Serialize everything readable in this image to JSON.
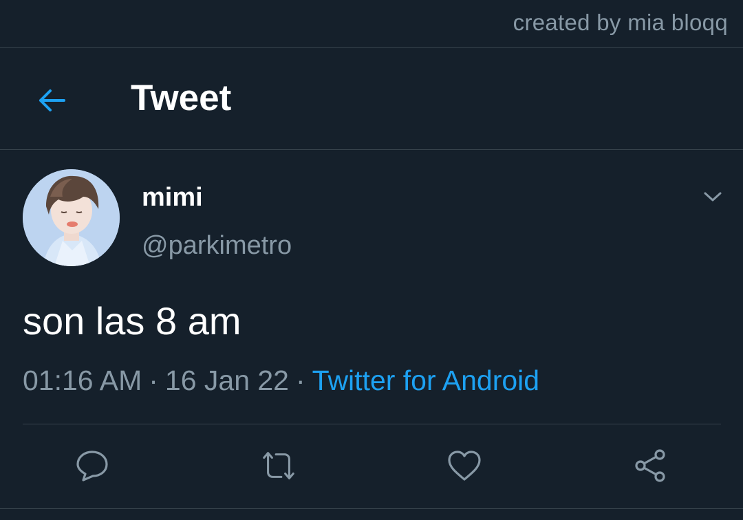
{
  "watermark": "created by mia bloqq",
  "header": {
    "back_icon": "arrow-left-icon",
    "title": "Tweet"
  },
  "tweet": {
    "author": {
      "display_name": "mimi",
      "handle": "@parkimetro"
    },
    "text": "son las 8 am",
    "time": "01:16 AM",
    "separator": "·",
    "date": "16 Jan 22",
    "source": "Twitter for Android"
  },
  "actions": [
    {
      "icon": "reply-icon"
    },
    {
      "icon": "retweet-icon"
    },
    {
      "icon": "like-icon"
    },
    {
      "icon": "share-icon"
    }
  ],
  "colors": {
    "background": "#15202b",
    "accent": "#1da1f2",
    "secondary_text": "#8899a6",
    "divider": "#38444d"
  }
}
